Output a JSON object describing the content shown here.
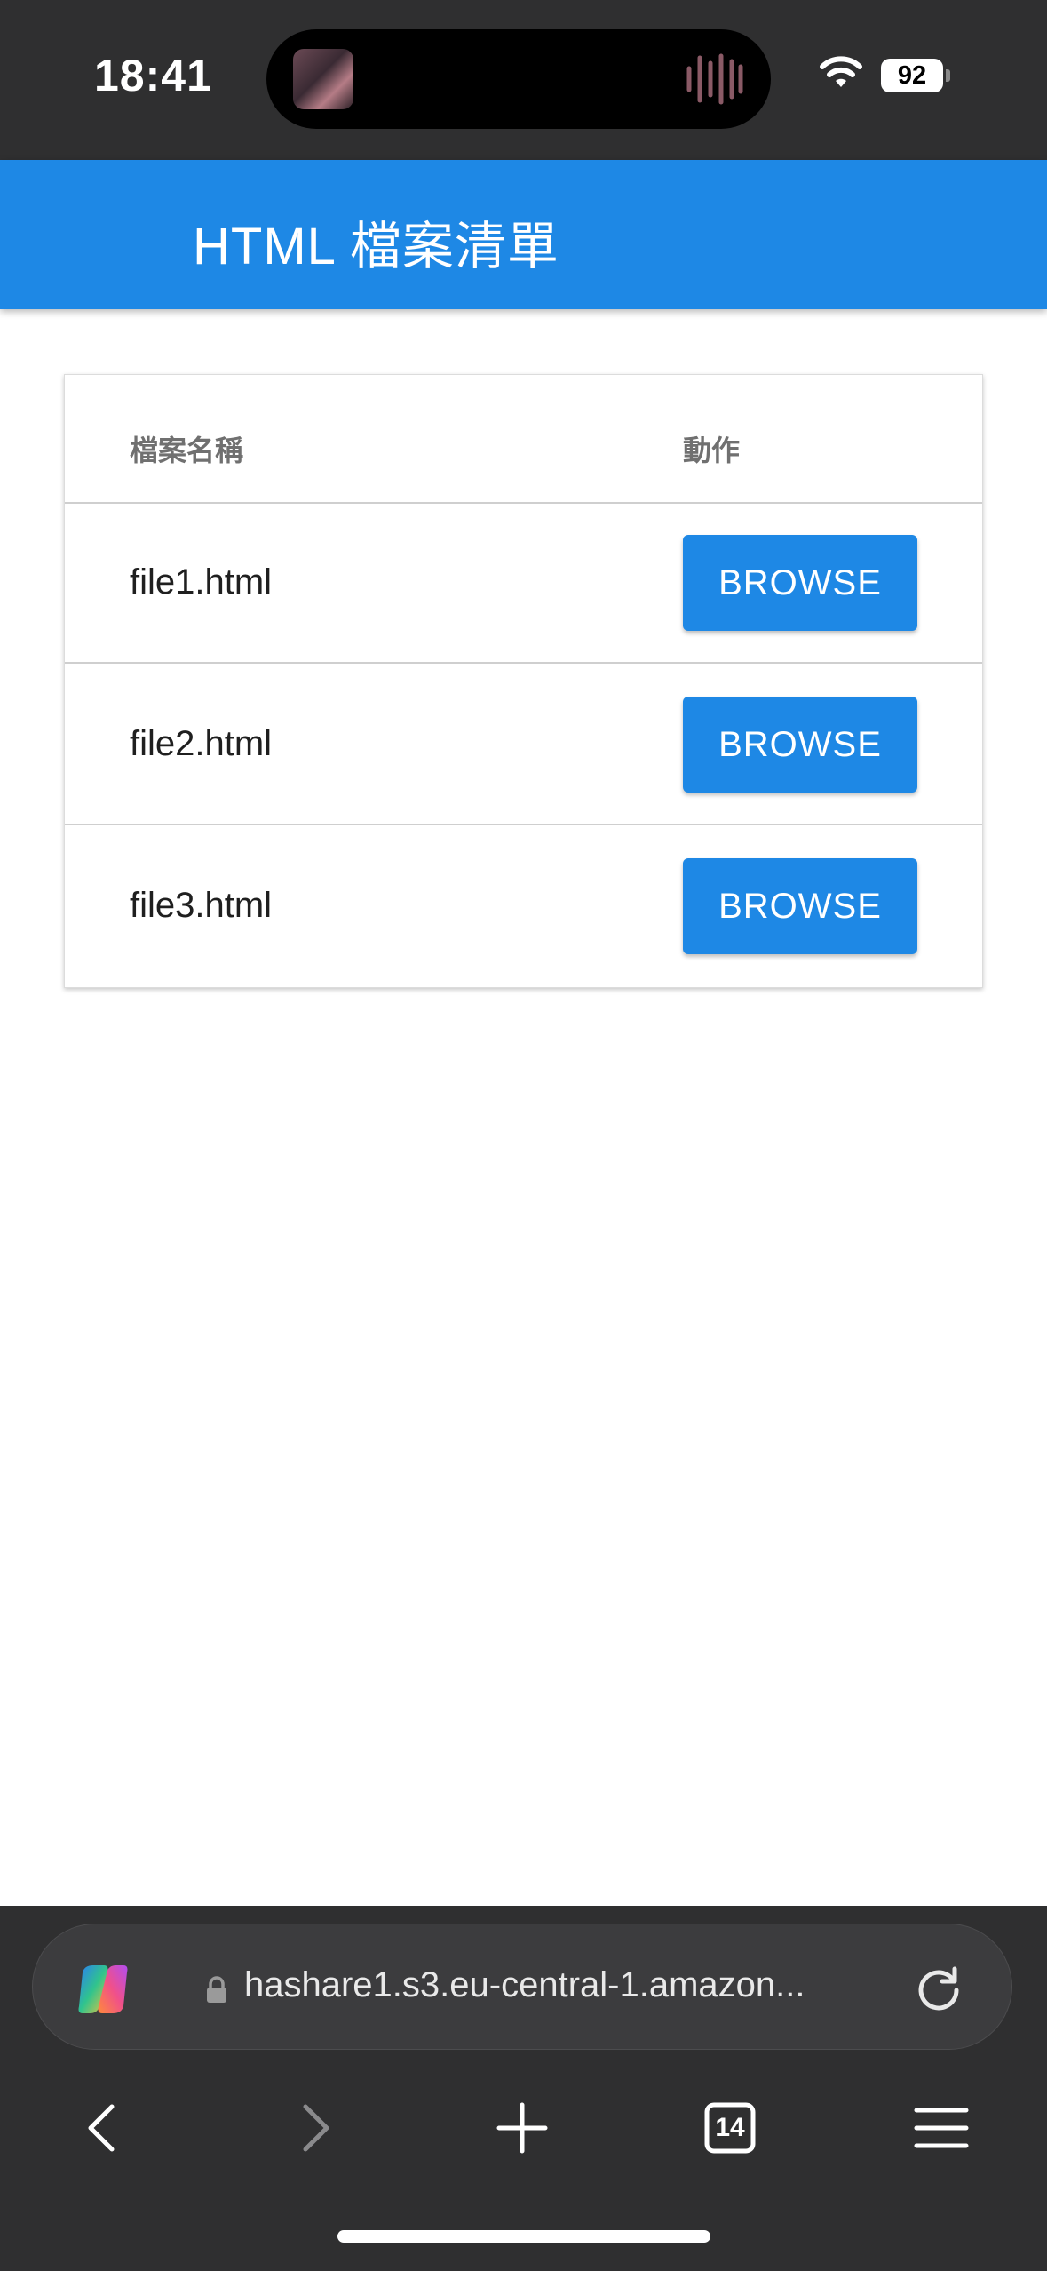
{
  "status_bar": {
    "time": "18:41",
    "battery": "92"
  },
  "app_bar": {
    "title": "HTML 檔案清單"
  },
  "table": {
    "headers": [
      "檔案名稱",
      "動作"
    ],
    "rows": [
      {
        "name": "file1.html",
        "action": "BROWSE"
      },
      {
        "name": "file2.html",
        "action": "BROWSE"
      },
      {
        "name": "file3.html",
        "action": "BROWSE"
      }
    ]
  },
  "browser": {
    "url": "hashare1.s3.eu-central-1.amazon...",
    "tab_count": "14"
  },
  "colors": {
    "primary": "#1e88e5",
    "chrome": "#2f2f30"
  }
}
